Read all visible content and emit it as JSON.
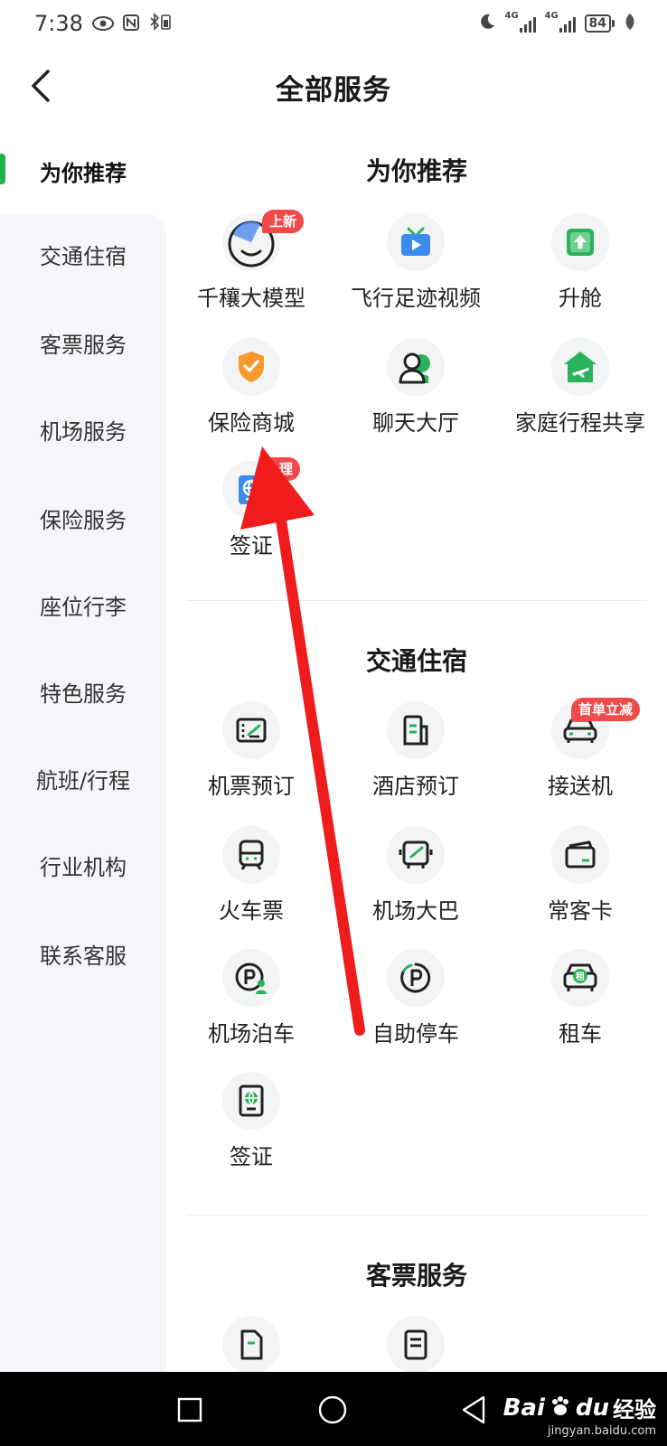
{
  "status": {
    "time": "7:38",
    "battery": "84",
    "net1": "4G",
    "net2": "4G"
  },
  "header": {
    "title": "全部服务"
  },
  "sidebar": {
    "items": [
      {
        "label": "为你推荐"
      },
      {
        "label": "交通住宿"
      },
      {
        "label": "客票服务"
      },
      {
        "label": "机场服务"
      },
      {
        "label": "保险服务"
      },
      {
        "label": "座位行李"
      },
      {
        "label": "特色服务"
      },
      {
        "label": "航班/行程"
      },
      {
        "label": "行业机构"
      },
      {
        "label": "联系客服"
      }
    ]
  },
  "sections": [
    {
      "title": "为你推荐",
      "items": [
        {
          "label": "千穰大模型",
          "icon": "ai-face-icon",
          "badge": "上新"
        },
        {
          "label": "飞行足迹视频",
          "icon": "tv-icon"
        },
        {
          "label": "升舱",
          "icon": "upgrade-icon"
        },
        {
          "label": "保险商城",
          "icon": "shield-icon"
        },
        {
          "label": "聊天大厅",
          "icon": "chat-people-icon"
        },
        {
          "label": "家庭行程共享",
          "icon": "home-plane-icon"
        },
        {
          "label": "签证",
          "icon": "visa-icon",
          "badge": "办理"
        }
      ]
    },
    {
      "title": "交通住宿",
      "items": [
        {
          "label": "机票预订",
          "icon": "ticket-icon"
        },
        {
          "label": "酒店预订",
          "icon": "hotel-icon"
        },
        {
          "label": "接送机",
          "icon": "car-icon",
          "badge": "首单立减"
        },
        {
          "label": "火车票",
          "icon": "train-icon"
        },
        {
          "label": "机场大巴",
          "icon": "bus-icon"
        },
        {
          "label": "常客卡",
          "icon": "card-icon"
        },
        {
          "label": "机场泊车",
          "icon": "parking-person-icon"
        },
        {
          "label": "自助停车",
          "icon": "parking-icon"
        },
        {
          "label": "租车",
          "icon": "rent-car-icon"
        },
        {
          "label": "签证",
          "icon": "passport-icon"
        }
      ]
    },
    {
      "title": "客票服务",
      "items": [
        {
          "label": "",
          "icon": "document-icon"
        },
        {
          "label": "",
          "icon": "list-icon"
        }
      ]
    }
  ],
  "rent_char": "租",
  "watermark": {
    "brand": "Bai",
    "brand2": "du",
    "cn": "经验",
    "url": "jingyan.baidu.com"
  },
  "colors": {
    "accent": "#22b24c",
    "badge": "#f04a4a",
    "arrow": "#ee1c1c",
    "icon_green": "#2bb25a",
    "icon_blue": "#3c8cf0",
    "icon_orange": "#f79a2d"
  }
}
